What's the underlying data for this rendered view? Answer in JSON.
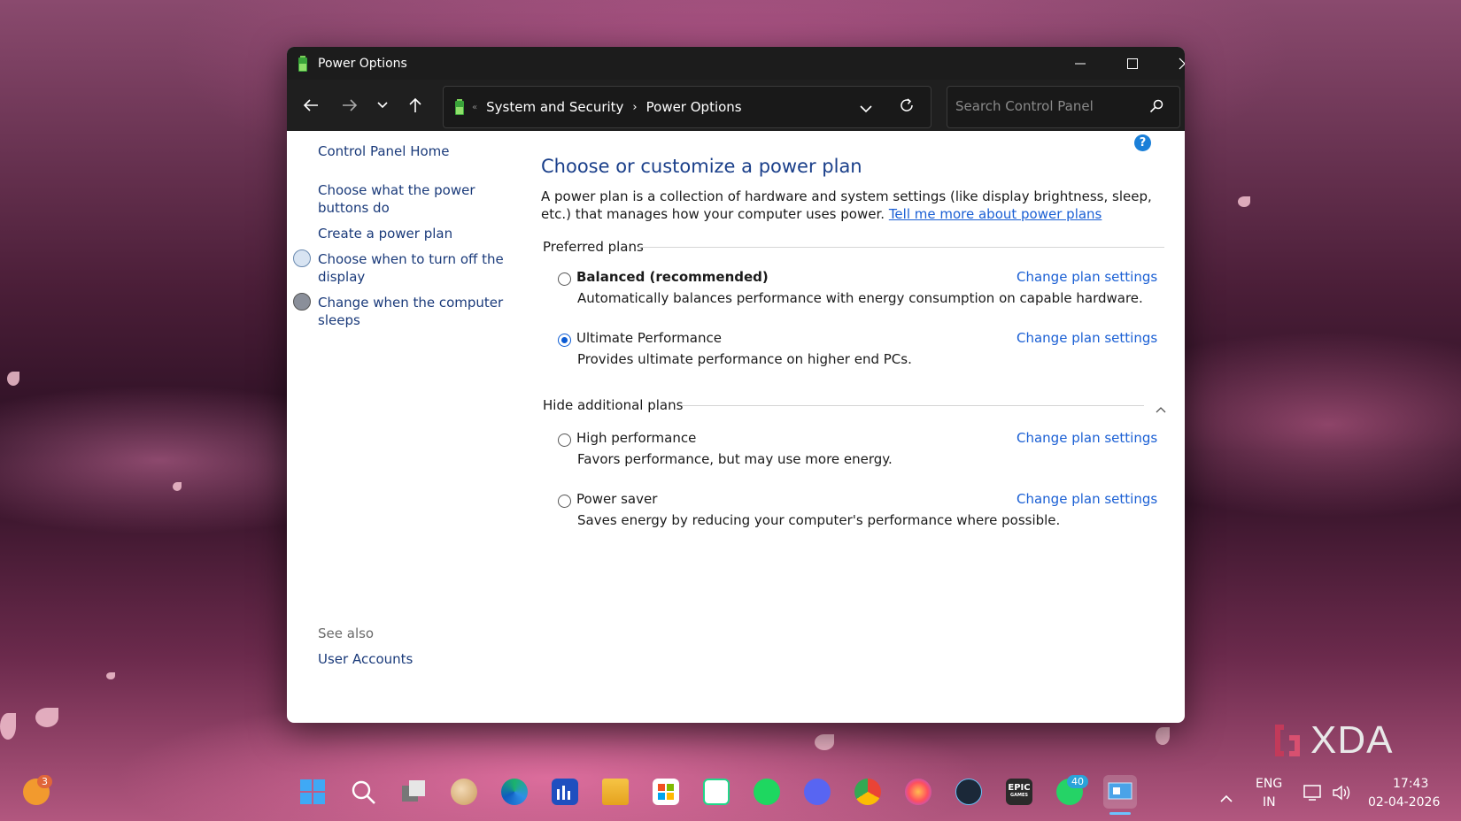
{
  "window": {
    "title": "Power Options",
    "minimize_icon": "minimize-icon",
    "maximize_icon": "maximize-icon",
    "close_icon": "close-icon"
  },
  "navigation": {
    "breadcrumb": [
      "System and Security",
      "Power Options"
    ],
    "search_placeholder": "Search Control Panel"
  },
  "sidebar": {
    "home": "Control Panel Home",
    "links": [
      "Choose what the power buttons do",
      "Create a power plan",
      "Choose when to turn off the display",
      "Change when the computer sleeps"
    ],
    "see_also_label": "See also",
    "see_also_links": [
      "User Accounts"
    ]
  },
  "main": {
    "title": "Choose or customize a power plan",
    "description": "A power plan is a collection of hardware and system settings (like display brightness, sleep, etc.) that manages how your computer uses power.",
    "description_link": "Tell me more about power plans",
    "preferred_label": "Preferred plans",
    "additional_label": "Hide additional plans",
    "change_label": "Change plan settings",
    "plans": [
      {
        "name": "Balanced (recommended)",
        "description": "Automatically balances performance with energy consumption on capable hardware.",
        "selected": false,
        "bold": true
      },
      {
        "name": "Ultimate Performance",
        "description": "Provides ultimate performance on higher end PCs.",
        "selected": true,
        "bold": false
      },
      {
        "name": "High performance",
        "description": "Favors performance, but may use more energy.",
        "selected": false,
        "bold": false
      },
      {
        "name": "Power saver",
        "description": "Saves energy by reducing your computer's performance where possible.",
        "selected": false,
        "bold": false
      }
    ]
  },
  "taskbar": {
    "weather_badge": "3",
    "whatsapp_badge": "40",
    "epic_label": "EPIC",
    "epic_sublabel": "GAMES",
    "language": "ENG",
    "region": "IN",
    "time": "17:43",
    "date": "02-04-2026"
  },
  "watermark": "XDA",
  "colors": {
    "accent": "#0b5bd4",
    "link": "#1a5fd4",
    "title_blue": "#1a3f8a",
    "titlebar_bg": "#1c1c1c"
  }
}
